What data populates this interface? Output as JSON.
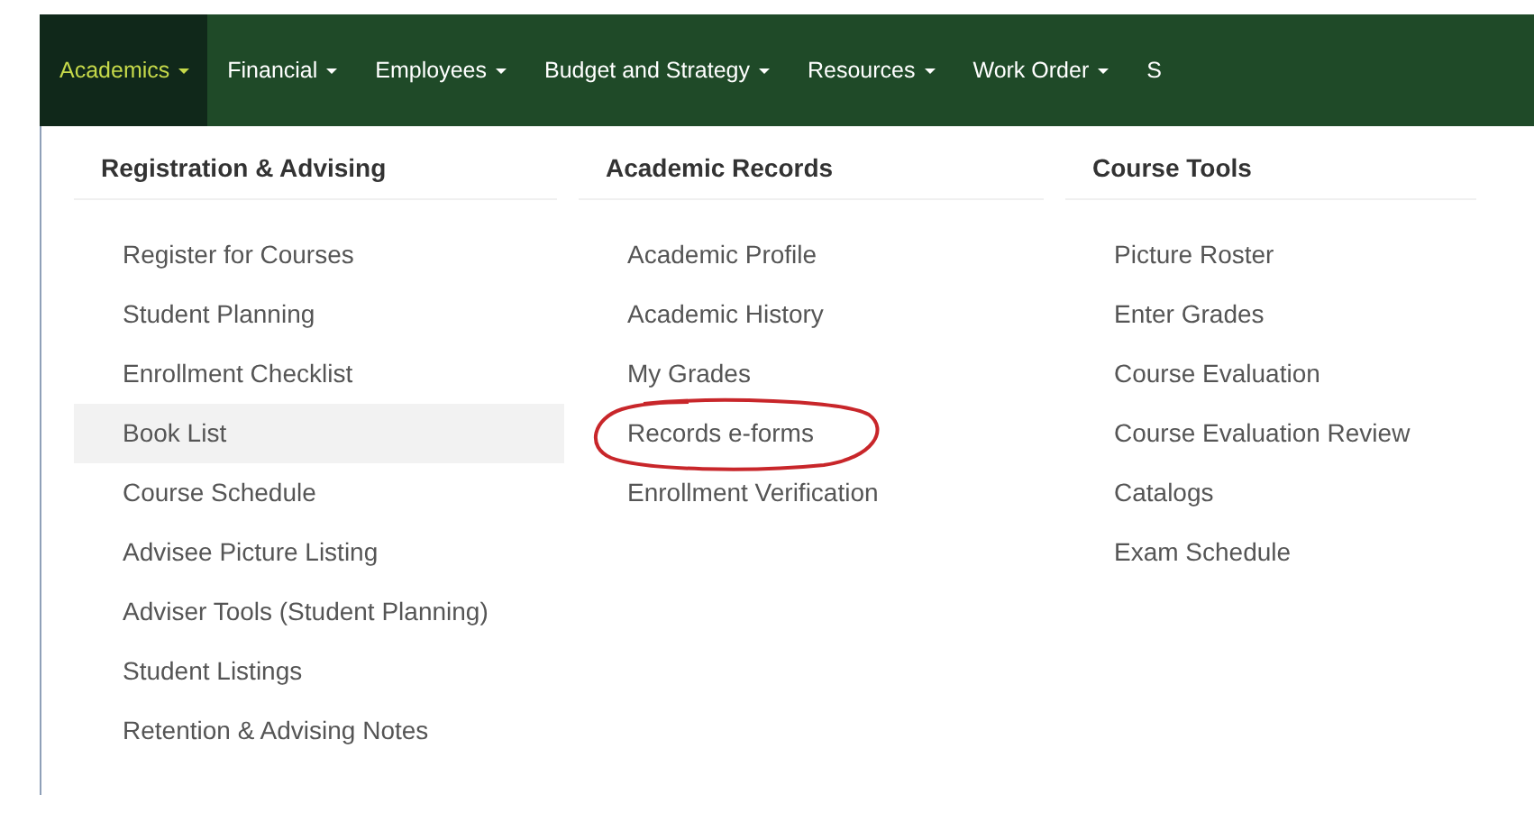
{
  "nav": [
    {
      "label": "Academics",
      "selected": true,
      "dropdown": true
    },
    {
      "label": "Financial",
      "selected": false,
      "dropdown": true
    },
    {
      "label": "Employees",
      "selected": false,
      "dropdown": true
    },
    {
      "label": "Budget and Strategy",
      "selected": false,
      "dropdown": true
    },
    {
      "label": "Resources",
      "selected": false,
      "dropdown": true
    },
    {
      "label": "Work Order",
      "selected": false,
      "dropdown": true
    },
    {
      "label": "S",
      "selected": false,
      "dropdown": false
    }
  ],
  "menu": {
    "columns": [
      {
        "heading": "Registration & Advising",
        "items": [
          {
            "label": "Register for Courses",
            "hovered": false,
            "circled": false
          },
          {
            "label": "Student Planning",
            "hovered": false,
            "circled": false
          },
          {
            "label": "Enrollment Checklist",
            "hovered": false,
            "circled": false
          },
          {
            "label": "Book List",
            "hovered": true,
            "circled": false
          },
          {
            "label": "Course Schedule",
            "hovered": false,
            "circled": false
          },
          {
            "label": "Advisee Picture Listing",
            "hovered": false,
            "circled": false
          },
          {
            "label": "Adviser Tools (Student Planning)",
            "hovered": false,
            "circled": false
          },
          {
            "label": "Student Listings",
            "hovered": false,
            "circled": false
          },
          {
            "label": "Retention & Advising Notes",
            "hovered": false,
            "circled": false
          }
        ]
      },
      {
        "heading": "Academic Records",
        "items": [
          {
            "label": "Academic Profile",
            "hovered": false,
            "circled": false
          },
          {
            "label": "Academic History",
            "hovered": false,
            "circled": false
          },
          {
            "label": "My Grades",
            "hovered": false,
            "circled": false
          },
          {
            "label": "Records e-forms",
            "hovered": false,
            "circled": true
          },
          {
            "label": "Enrollment Verification",
            "hovered": false,
            "circled": false
          }
        ]
      },
      {
        "heading": "Course Tools",
        "items": [
          {
            "label": "Picture Roster",
            "hovered": false,
            "circled": false
          },
          {
            "label": "Enter Grades",
            "hovered": false,
            "circled": false
          },
          {
            "label": "Course Evaluation",
            "hovered": false,
            "circled": false
          },
          {
            "label": "Course Evaluation Review",
            "hovered": false,
            "circled": false
          },
          {
            "label": "Catalogs",
            "hovered": false,
            "circled": false
          },
          {
            "label": "Exam Schedule",
            "hovered": false,
            "circled": false
          }
        ]
      }
    ]
  }
}
